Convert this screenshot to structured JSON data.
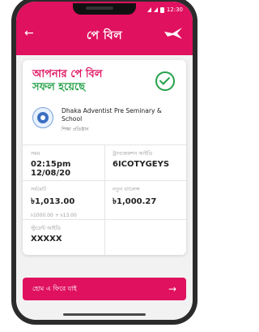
{
  "status_bar": {
    "time": "12:30"
  },
  "header": {
    "title": "পে বিল"
  },
  "result": {
    "line1": "আপনার পে বিল",
    "line2": "সফল হয়েছে"
  },
  "merchant": {
    "name": "Dhaka Adventist Pre Seminary & School",
    "category": "শিক্ষা প্রতিষ্ঠান"
  },
  "details": {
    "time_label": "সময়",
    "time_value": "02:15pm 12/08/20",
    "txn_label": "ট্রানজেকশন আইডি",
    "txn_value": "6ICOTYGEYS",
    "total_label": "সর্বমোট",
    "total_value": "৳1,013.00",
    "total_breakdown": "৳1000.00 + ৳13.00",
    "balance_label": "নতুন ব্যালেন্স",
    "balance_value": "৳1,000.27",
    "student_label": "স্টুডেন্ট আইডি",
    "student_value": "XXXXX"
  },
  "actions": {
    "home_label": "হোম এ ফিরে যাই"
  },
  "icons": {
    "back": "back-arrow-icon",
    "brand": "bird-logo-icon",
    "check": "check-circle-icon",
    "home_arrow": "arrow-right-icon"
  },
  "colors": {
    "accent": "#e0115f",
    "success": "#24a148"
  }
}
